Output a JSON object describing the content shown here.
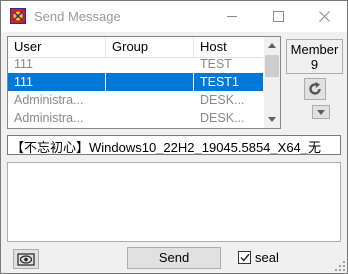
{
  "window": {
    "title": "Send Message"
  },
  "list": {
    "columns": [
      "User",
      "Group",
      "Host"
    ],
    "rows": [
      {
        "user": "111",
        "group": "",
        "host": "TEST",
        "selected": false
      },
      {
        "user": "111",
        "group": "",
        "host": "TEST1",
        "selected": true
      },
      {
        "user": "Administra...",
        "group": "",
        "host": "DESK...",
        "selected": false
      },
      {
        "user": "Administra...",
        "group": "",
        "host": "DESK...",
        "selected": false
      }
    ]
  },
  "member": {
    "label": "Member",
    "count": "9"
  },
  "info": {
    "text": "【不忘初心】Windows10_22H2_19045.5854_X64_无"
  },
  "message": {
    "value": ""
  },
  "footer": {
    "send_label": "Send",
    "seal_label": "seal",
    "seal_checked": true
  },
  "icons": {
    "app": "app-icon",
    "minimize": "minimize-icon",
    "maximize": "maximize-icon",
    "close": "close-icon",
    "refresh": "refresh-icon",
    "dropdown": "dropdown-arrow-icon",
    "screenshot": "eye-icon",
    "checkmark": "checkmark-icon"
  },
  "colors": {
    "selection": "#0078d7",
    "window_bg": "#f0f0f0"
  }
}
